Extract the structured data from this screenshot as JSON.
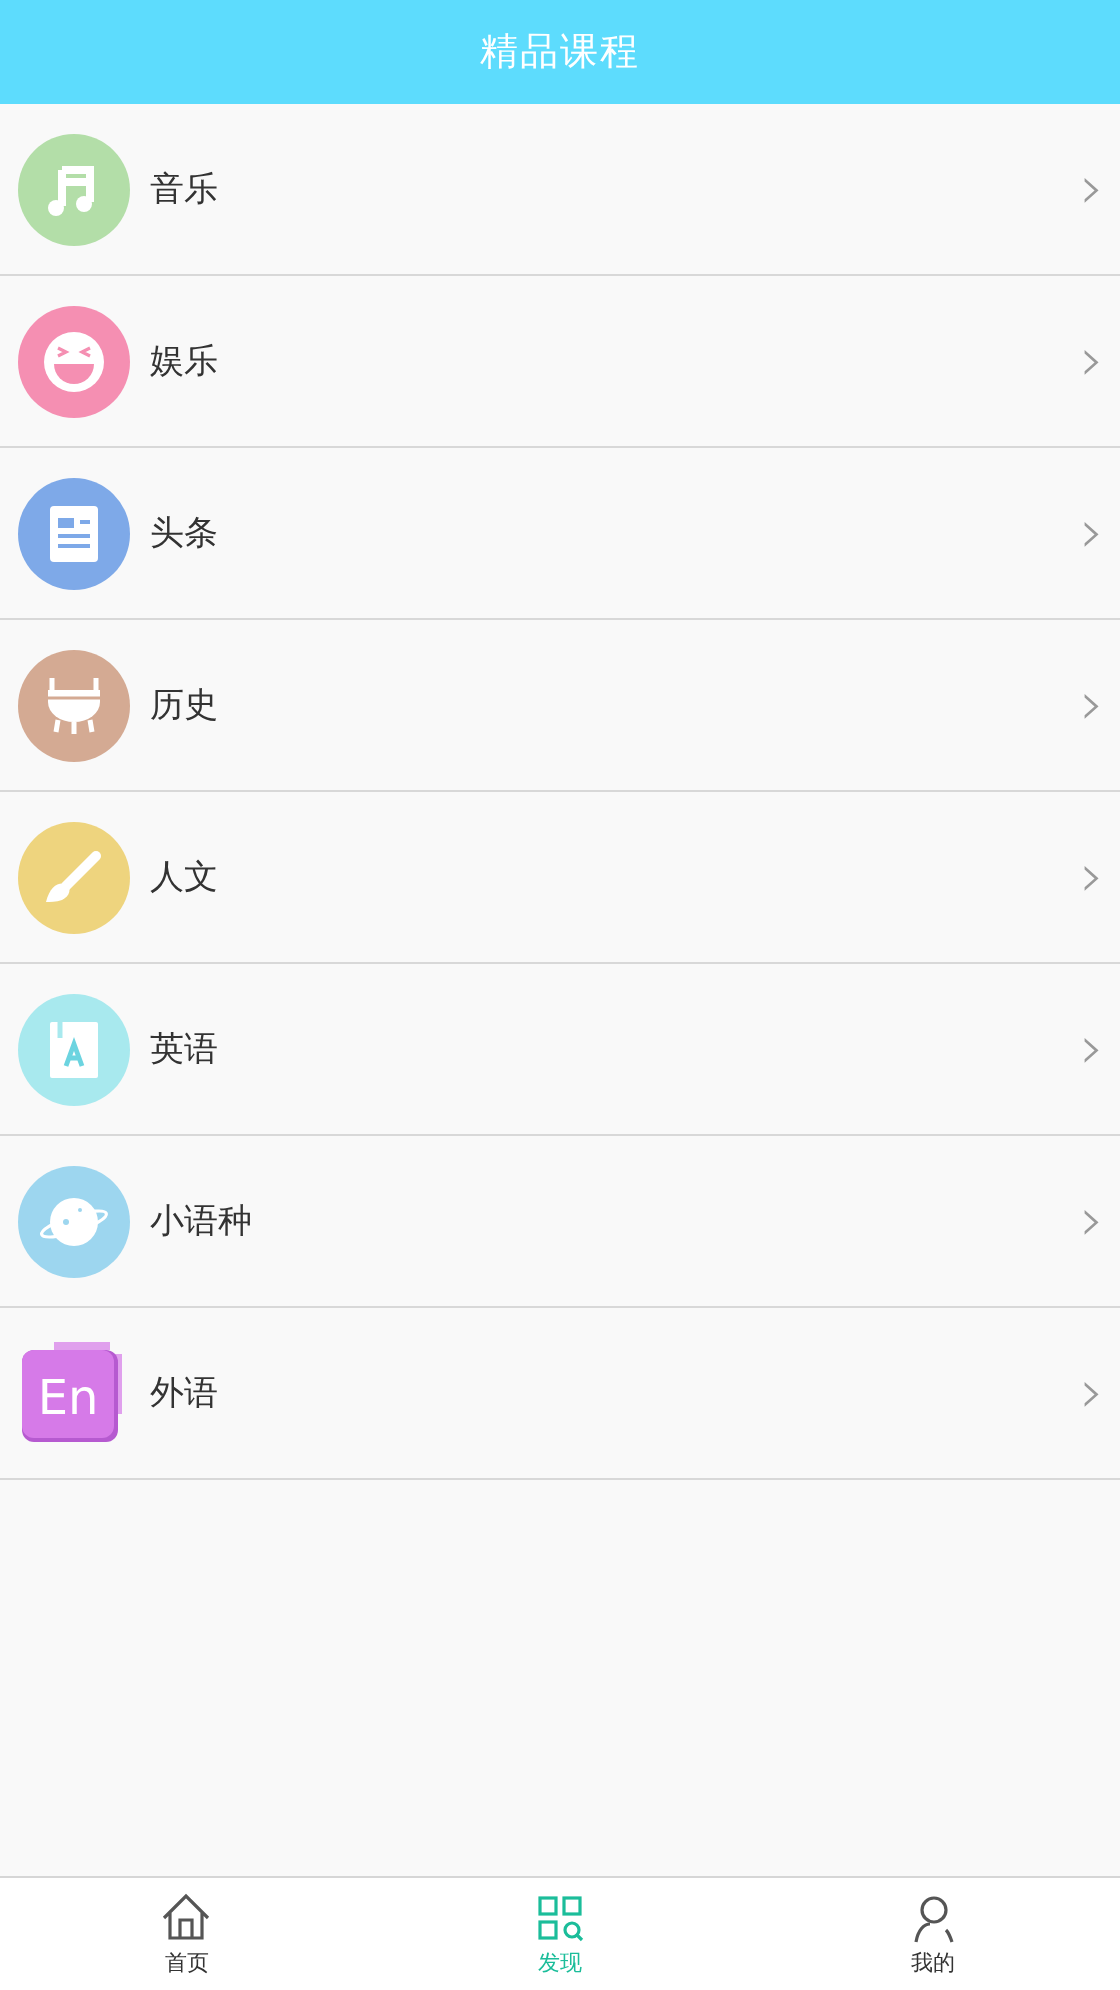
{
  "header": {
    "title": "精品课程"
  },
  "categories": [
    {
      "kind": "music",
      "color": "#b3dea8",
      "label": "音乐",
      "chevron": "›"
    },
    {
      "kind": "smile",
      "color": "#f58fb2",
      "label": "娱乐",
      "chevron": "›"
    },
    {
      "kind": "news",
      "color": "#7ea9e8",
      "label": "头条",
      "chevron": "›"
    },
    {
      "kind": "cauldron",
      "color": "#d4aa93",
      "label": "历史",
      "chevron": "›"
    },
    {
      "kind": "brush",
      "color": "#eed47e",
      "label": "人文",
      "chevron": "›"
    },
    {
      "kind": "book",
      "color": "#a8e9ee",
      "label": "英语",
      "chevron": "›"
    },
    {
      "kind": "planet",
      "color": "#9dd6ef",
      "label": "小语种",
      "chevron": "›"
    },
    {
      "kind": "badge",
      "color": "#d67ae8",
      "label": "外语",
      "badge_text": "En",
      "chevron": "›"
    }
  ],
  "tabs": [
    {
      "kind": "home",
      "label": "首页",
      "selected": false
    },
    {
      "kind": "discover",
      "label": "发现",
      "selected": true
    },
    {
      "kind": "profile",
      "label": "我的",
      "selected": false
    }
  ]
}
